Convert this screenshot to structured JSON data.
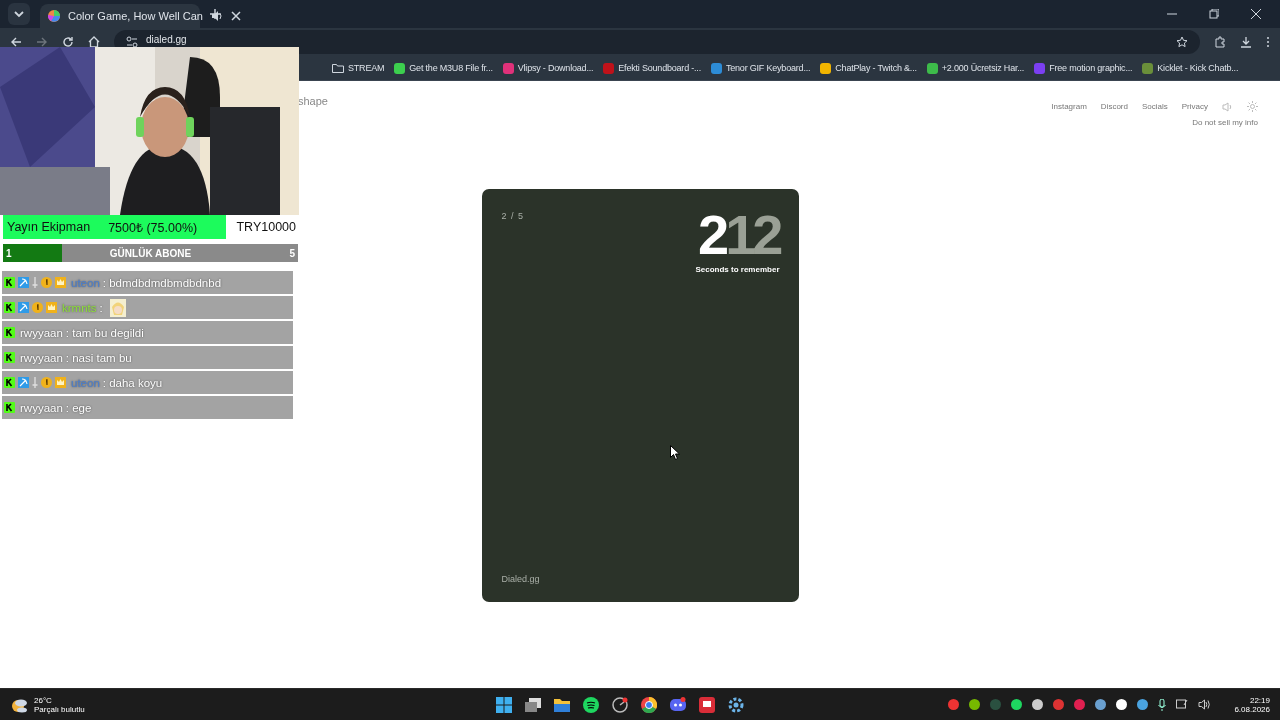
{
  "browser": {
    "tab": {
      "title": "Color Game, How Well Can",
      "selected": true
    },
    "address": "dialed.gg",
    "bookmarks": [
      {
        "title": "STREAM",
        "kind": "folder"
      },
      {
        "title": "Get the M3U8 File fr...",
        "kind": "site",
        "color": "#3ccf4e"
      },
      {
        "title": "Vlipsy - Download...",
        "kind": "site",
        "color": "#e0317a"
      },
      {
        "title": "Efekti Soundboard -...",
        "kind": "site",
        "color": "#c0121a"
      },
      {
        "title": "Tenor GIF Keyboard...",
        "kind": "site",
        "color": "#2d8cd6"
      },
      {
        "title": "ChatPlay - Twitch &...",
        "kind": "site",
        "color": "#f0b400"
      },
      {
        "title": "+2.000 Ücretsiz Har...",
        "kind": "site",
        "color": "#3dbb4a"
      },
      {
        "title": "Free motion graphic...",
        "kind": "site",
        "color": "#7b3ff2"
      },
      {
        "title": "Kicklet - Kick Chatb...",
        "kind": "site",
        "color": "#6a8f3a"
      }
    ]
  },
  "page": {
    "logo": "shape",
    "links": [
      "Instagram",
      "Discord",
      "Socials",
      "Privacy"
    ],
    "footer_link": "Do not sell my info",
    "card": {
      "round": "2 / 5",
      "timer_current": "2",
      "timer_rest": "12",
      "timer_label": "Seconds to remember",
      "brand": "Dialed.gg"
    }
  },
  "overlay": {
    "goal": {
      "label": "Yayın Ekipman",
      "amount": "7500₺ (75.00%)",
      "target": "TRY10000",
      "level": 0.75
    },
    "sub_goal": {
      "start": "1",
      "label": "GÜNLÜK ABONE",
      "end": "5",
      "level": 0.2
    },
    "chat": [
      {
        "badges": [
          {
            "kind": "kick"
          },
          {
            "kind": "pick"
          },
          {
            "kind": "sword"
          },
          {
            "kind": "coin"
          },
          {
            "kind": "crown"
          }
        ],
        "user": "uteon",
        "color": "#4a7fd0",
        "message": ": bdmdbdmdbmdbdnbd"
      },
      {
        "badges": [
          {
            "kind": "kick"
          },
          {
            "kind": "pick"
          },
          {
            "kind": "coin"
          },
          {
            "kind": "crown"
          }
        ],
        "user": "krmnts",
        "color": "#8ee03a",
        "message": ":",
        "emote": true
      },
      {
        "badges": [
          {
            "kind": "kick"
          }
        ],
        "user": "rwyyaan",
        "color": "#ffffff",
        "message": ": tam bu degildi"
      },
      {
        "badges": [
          {
            "kind": "kick"
          }
        ],
        "user": "rwyyaan",
        "color": "#ffffff",
        "message": ": nasi tam bu"
      },
      {
        "badges": [
          {
            "kind": "kick"
          },
          {
            "kind": "pick"
          },
          {
            "kind": "sword"
          },
          {
            "kind": "coin"
          },
          {
            "kind": "crown"
          }
        ],
        "user": "uteon",
        "color": "#4a7fd0",
        "message": ": daha koyu"
      },
      {
        "badges": [
          {
            "kind": "kick"
          }
        ],
        "user": "rwyyaan",
        "color": "#ffffff",
        "message": ": ege"
      }
    ]
  },
  "taskbar": {
    "weather": {
      "temp": "26°C",
      "desc": "Parçalı bulutlu"
    },
    "time": "22:19",
    "date": "6.08.2026"
  }
}
